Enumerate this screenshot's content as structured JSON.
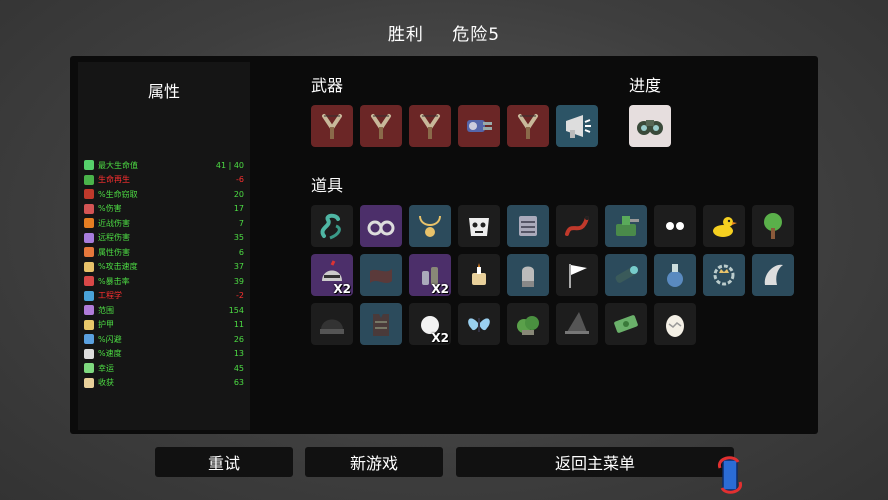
{
  "header": {
    "result": "胜利",
    "danger": "危险5"
  },
  "stats": {
    "title": "属性",
    "rows": [
      {
        "label": "最大生命值",
        "value": "41 | 40",
        "color": "#4ddd44",
        "icon_color": "#56d16b",
        "negative": false
      },
      {
        "label": "生命再生",
        "value": "-6",
        "color": "#ff3030",
        "icon_color": "#4ab34a",
        "negative": true
      },
      {
        "label": "%生命窃取",
        "value": "20",
        "color": "#4ddd44",
        "icon_color": "#c0392b",
        "negative": false
      },
      {
        "label": "%伤害",
        "value": "17",
        "color": "#4ddd44",
        "icon_color": "#d35454",
        "negative": false
      },
      {
        "label": "近战伤害",
        "value": "7",
        "color": "#4ddd44",
        "icon_color": "#e67e22",
        "negative": false
      },
      {
        "label": "远程伤害",
        "value": "35",
        "color": "#4ddd44",
        "icon_color": "#a77ddc",
        "negative": false
      },
      {
        "label": "属性伤害",
        "value": "6",
        "color": "#4ddd44",
        "icon_color": "#e6783c",
        "negative": false
      },
      {
        "label": "%攻击速度",
        "value": "37",
        "color": "#4ddd44",
        "icon_color": "#e8c26a",
        "negative": false
      },
      {
        "label": "%暴击率",
        "value": "39",
        "color": "#4ddd44",
        "icon_color": "#d94848",
        "negative": false
      },
      {
        "label": "工程学",
        "value": "-2",
        "color": "#ff3030",
        "icon_color": "#4aa3d9",
        "negative": true
      },
      {
        "label": "范围",
        "value": "154",
        "color": "#4ddd44",
        "icon_color": "#b07cd9",
        "negative": false
      },
      {
        "label": "护甲",
        "value": "11",
        "color": "#4ddd44",
        "icon_color": "#e8c86a",
        "negative": false
      },
      {
        "label": "%闪避",
        "value": "26",
        "color": "#4ddd44",
        "icon_color": "#5aa0e0",
        "negative": false
      },
      {
        "label": "%速度",
        "value": "13",
        "color": "#4ddd44",
        "icon_color": "#dddddd",
        "negative": false
      },
      {
        "label": "幸运",
        "value": "45",
        "color": "#4ddd44",
        "icon_color": "#7fd97f",
        "negative": false
      },
      {
        "label": "收获",
        "value": "63",
        "color": "#4ddd44",
        "icon_color": "#e8d09a",
        "negative": false
      }
    ]
  },
  "weapons": {
    "title": "武器",
    "items": [
      {
        "icon": "slingshot-icon",
        "tier": "red"
      },
      {
        "icon": "slingshot-icon",
        "tier": "red"
      },
      {
        "icon": "slingshot-icon",
        "tier": "red"
      },
      {
        "icon": "minigun-icon",
        "tier": "red"
      },
      {
        "icon": "slingshot-icon",
        "tier": "red"
      },
      {
        "icon": "megaphone-gun-icon",
        "tier": "blue"
      }
    ]
  },
  "progress": {
    "title": "进度",
    "items": [
      {
        "icon": "binoculars-icon"
      }
    ]
  },
  "items": {
    "title": "道具",
    "rows": [
      [
        {
          "icon": "tentacle-icon",
          "tier": "black",
          "count": ""
        },
        {
          "icon": "handcuffs-icon",
          "tier": "purple",
          "count": ""
        },
        {
          "icon": "pendant-icon",
          "tier": "blue",
          "count": ""
        },
        {
          "icon": "skull-mask-icon",
          "tier": "black",
          "count": ""
        },
        {
          "icon": "scroll-armor-icon",
          "tier": "blue",
          "count": ""
        },
        {
          "icon": "snake-icon",
          "tier": "black",
          "count": ""
        },
        {
          "icon": "turret-icon",
          "tier": "blue",
          "count": ""
        },
        {
          "icon": "eyes-icon",
          "tier": "black",
          "count": ""
        },
        {
          "icon": "duck-icon",
          "tier": "black",
          "count": ""
        },
        {
          "icon": "tree-icon",
          "tier": "black",
          "count": ""
        }
      ],
      [
        {
          "icon": "helmet-knight-icon",
          "tier": "purple",
          "count": "X2"
        },
        {
          "icon": "fabric-icon",
          "tier": "blue",
          "count": ""
        },
        {
          "icon": "potion-bottles-icon",
          "tier": "purple",
          "count": "X2"
        },
        {
          "icon": "candle-jar-icon",
          "tier": "black",
          "count": ""
        },
        {
          "icon": "bullet-icon",
          "tier": "blue",
          "count": ""
        },
        {
          "icon": "white-flag-icon",
          "tier": "black",
          "count": ""
        },
        {
          "icon": "scope-icon",
          "tier": "blue",
          "count": ""
        },
        {
          "icon": "flask-icon",
          "tier": "blue",
          "count": ""
        },
        {
          "icon": "crown-chain-icon",
          "tier": "blue",
          "count": ""
        },
        {
          "icon": "claw-icon",
          "tier": "blue",
          "count": ""
        }
      ],
      [
        {
          "icon": "beanie-icon",
          "tier": "black",
          "count": ""
        },
        {
          "icon": "vest-icon",
          "tier": "blue",
          "count": ""
        },
        {
          "icon": "snowball-icon",
          "tier": "black",
          "count": "X2"
        },
        {
          "icon": "butterfly-icon",
          "tier": "black",
          "count": ""
        },
        {
          "icon": "bush-icon",
          "tier": "black",
          "count": ""
        },
        {
          "icon": "witch-hat-icon",
          "tier": "black",
          "count": ""
        },
        {
          "icon": "money-icon",
          "tier": "black",
          "count": ""
        },
        {
          "icon": "egg-icon",
          "tier": "black",
          "count": ""
        }
      ]
    ]
  },
  "buttons": {
    "retry": "重试",
    "new_game": "新游戏",
    "main_menu": "返回主菜单"
  }
}
